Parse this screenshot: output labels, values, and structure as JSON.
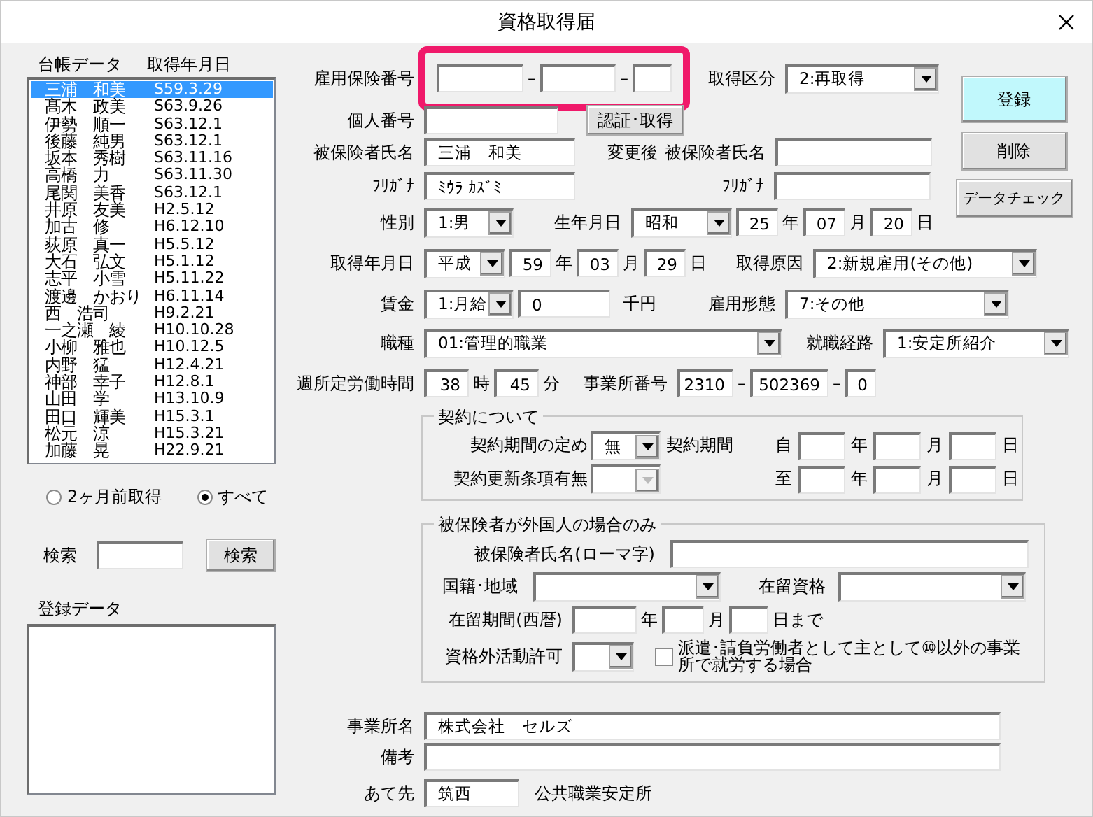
{
  "window": {
    "title": "資格取得届"
  },
  "ledger": {
    "headers": [
      "台帳データ",
      "取得年月日"
    ],
    "rows": [
      {
        "name": "三浦　和美",
        "date": "S59.3.29",
        "selected": true
      },
      {
        "name": "髙木　政美",
        "date": "S63.9.26",
        "selected": false
      },
      {
        "name": "伊勢　順一",
        "date": "S63.12.1",
        "selected": false
      },
      {
        "name": "後藤　純男",
        "date": "S63.12.1",
        "selected": false
      },
      {
        "name": "坂本　秀樹",
        "date": "S63.11.16",
        "selected": false
      },
      {
        "name": "高橋　力",
        "date": "S63.11.30",
        "selected": false
      },
      {
        "name": "尾関　美香",
        "date": "S63.12.1",
        "selected": false
      },
      {
        "name": "井原　友美",
        "date": "H2.5.12",
        "selected": false
      },
      {
        "name": "加古　修",
        "date": "H6.12.10",
        "selected": false
      },
      {
        "name": "荻原　真一",
        "date": "H5.5.12",
        "selected": false
      },
      {
        "name": "大石　弘文",
        "date": "H5.1.12",
        "selected": false
      },
      {
        "name": "志平　小雪",
        "date": "H5.11.22",
        "selected": false
      },
      {
        "name": "渡邊　かおり",
        "date": "H6.11.14",
        "selected": false
      },
      {
        "name": "西　浩司",
        "date": "H9.2.21",
        "selected": false
      },
      {
        "name": "一之瀬　綾",
        "date": "H10.10.28",
        "selected": false
      },
      {
        "name": "小柳　雅也",
        "date": "H10.12.5",
        "selected": false
      },
      {
        "name": "内野　猛",
        "date": "H12.4.21",
        "selected": false
      },
      {
        "name": "神部　幸子",
        "date": "H12.8.1",
        "selected": false
      },
      {
        "name": "山田　学",
        "date": "H13.10.9",
        "selected": false
      },
      {
        "name": "田口　輝美",
        "date": "H15.3.1",
        "selected": false
      },
      {
        "name": "松元　涼",
        "date": "H15.3.21",
        "selected": false
      },
      {
        "name": "加藤　晃",
        "date": "H22.9.21",
        "selected": false
      }
    ]
  },
  "filter": [
    {
      "label": "2ヶ月前取得",
      "selected": false
    },
    {
      "label": "すべて",
      "selected": true
    }
  ],
  "search": {
    "label": "検索",
    "button": "検索"
  },
  "registered": {
    "label": "登録データ"
  },
  "actions": [
    {
      "label": "登録",
      "primary": true
    },
    {
      "label": "削除",
      "primary": false
    },
    {
      "label": "データチェック",
      "primary": false
    }
  ],
  "form": {
    "insurance_number": {
      "label": "雇用保険番号",
      "highlighted": true,
      "separators": [
        "–",
        "–"
      ]
    },
    "acquisition_type": {
      "label": "取得区分",
      "value": "2:再取得"
    },
    "personal_number": {
      "label": "個人番号",
      "button": "認証･取得"
    },
    "insured_name": {
      "label": "被保険者氏名",
      "value": "三浦　和美"
    },
    "changed": {
      "label": "変更後",
      "name_label": "被保険者氏名",
      "furigana_label": "ﾌﾘｶﾞﾅ"
    },
    "furigana": {
      "label": "ﾌﾘｶﾞﾅ",
      "value": "ﾐｳﾗ ｶｽﾞﾐ"
    },
    "sex": {
      "label": "性別",
      "value": "1:男"
    },
    "birth": {
      "label": "生年月日",
      "era": "昭和",
      "year": "25",
      "year_unit": "年",
      "month": "07",
      "month_unit": "月",
      "day": "20",
      "day_unit": "日"
    },
    "acquired": {
      "label": "取得年月日",
      "era": "平成",
      "year": "59",
      "year_unit": "年",
      "month": "03",
      "month_unit": "月",
      "day": "29",
      "day_unit": "日"
    },
    "reason": {
      "label": "取得原因",
      "value": "2:新規雇用(その他)"
    },
    "wage": {
      "label": "賃金",
      "type": "1:月給",
      "amount": "0",
      "unit": "千円"
    },
    "employment_type": {
      "label": "雇用形態",
      "value": "7:その他"
    },
    "occupation": {
      "label": "職種",
      "value": "01:管理的職業"
    },
    "route": {
      "label": "就職経路",
      "value": "1:安定所紹介"
    },
    "weekly_hours": {
      "label": "週所定労働時間",
      "hours": "38",
      "hours_unit": "時",
      "minutes": "45",
      "minutes_unit": "分"
    },
    "office_number": {
      "label": "事業所番号",
      "parts": [
        "2310",
        "502369",
        "0"
      ],
      "separators": [
        "–",
        "–"
      ]
    },
    "contract": {
      "legend": "契約について",
      "rule_label": "契約期間の定め",
      "rule_value": "無",
      "period_label": "契約期間",
      "renewal_label": "契約更新条項有無",
      "renewal_disabled": true,
      "from": {
        "prefix": "自",
        "units": [
          "年",
          "月",
          "日"
        ]
      },
      "to": {
        "prefix": "至",
        "units": [
          "年",
          "月",
          "日"
        ]
      }
    },
    "foreign": {
      "legend": "被保険者が外国人の場合のみ",
      "roman_label": "被保険者氏名(ローマ字)",
      "nationality_label": "国籍･地域",
      "status_label": "在留資格",
      "period_label": "在留期間(西暦)",
      "period_units": [
        "年",
        "月",
        "日まで"
      ],
      "permission_label": "資格外活動許可",
      "dispatch": {
        "label": "派遣･請負労働者として主として⑩以外の事業所で就労する場合",
        "checked": false
      }
    },
    "office_name": {
      "label": "事業所名",
      "value": "株式会社　セルズ"
    },
    "remarks": {
      "label": "備考"
    },
    "destination": {
      "label": "あて先",
      "value": "筑西",
      "suffix": "公共職業安定所"
    }
  }
}
